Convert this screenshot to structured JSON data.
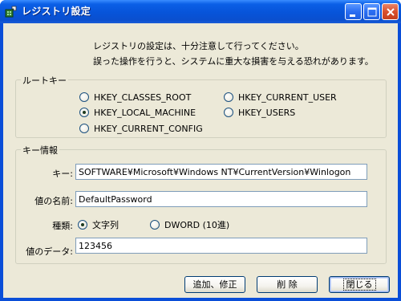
{
  "window": {
    "title": "レジストリ設定"
  },
  "intro": {
    "line1": "レジストリの設定は、十分注意して行ってください。",
    "line2": "誤った操作を行うと、システムに重大な損害を与える恐れがあります。"
  },
  "root_key": {
    "group_label": "ルートキー",
    "options": [
      {
        "label": "HKEY_CLASSES_ROOT",
        "checked": false
      },
      {
        "label": "HKEY_CURRENT_USER",
        "checked": false
      },
      {
        "label": "HKEY_LOCAL_MACHINE",
        "checked": true
      },
      {
        "label": "HKEY_USERS",
        "checked": false
      },
      {
        "label": "HKEY_CURRENT_CONFIG",
        "checked": false
      }
    ]
  },
  "key_info": {
    "group_label": "キー情報",
    "key_label": "キー:",
    "key_value": "SOFTWARE¥Microsoft¥Windows NT¥CurrentVersion¥Winlogon",
    "name_label": "値の名前:",
    "name_value": "DefaultPassword",
    "type_label": "種類:",
    "type_options": [
      {
        "label": "文字列",
        "checked": true
      },
      {
        "label": "DWORD (10進)",
        "checked": false
      }
    ],
    "data_label": "値のデータ:",
    "data_value": "123456"
  },
  "buttons": {
    "add_modify": "追加、修正",
    "delete": "削 除",
    "close": "閉じる"
  },
  "colors": {
    "titlebar": "#0754d9",
    "dialog_bg": "#ece9d8",
    "close_button": "#d9502d"
  }
}
